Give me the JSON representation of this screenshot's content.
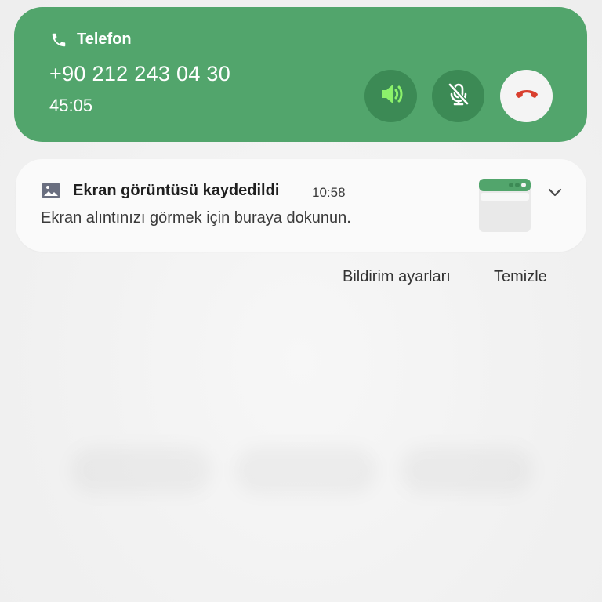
{
  "call": {
    "app_name": "Telefon",
    "phone_number": "+90 212 243 04 30",
    "duration": "45:05",
    "icons": {
      "app": "phone-icon",
      "speaker": "speaker-icon",
      "mute": "mic-off-icon",
      "end": "end-call-icon"
    },
    "colors": {
      "card": "#52a56c",
      "button": "#3c8a55",
      "speaker_active": "#8cf26b",
      "end_call": "#d93f2e"
    }
  },
  "notification": {
    "icon": "image-icon",
    "title": "Ekran görüntüsü kaydedildi",
    "time": "10:58",
    "body": "Ekran alıntınızı görmek için buraya dokunun.",
    "expand_icon": "chevron-down-icon"
  },
  "actions": {
    "settings_label": "Bildirim ayarları",
    "clear_label": "Temizle"
  }
}
